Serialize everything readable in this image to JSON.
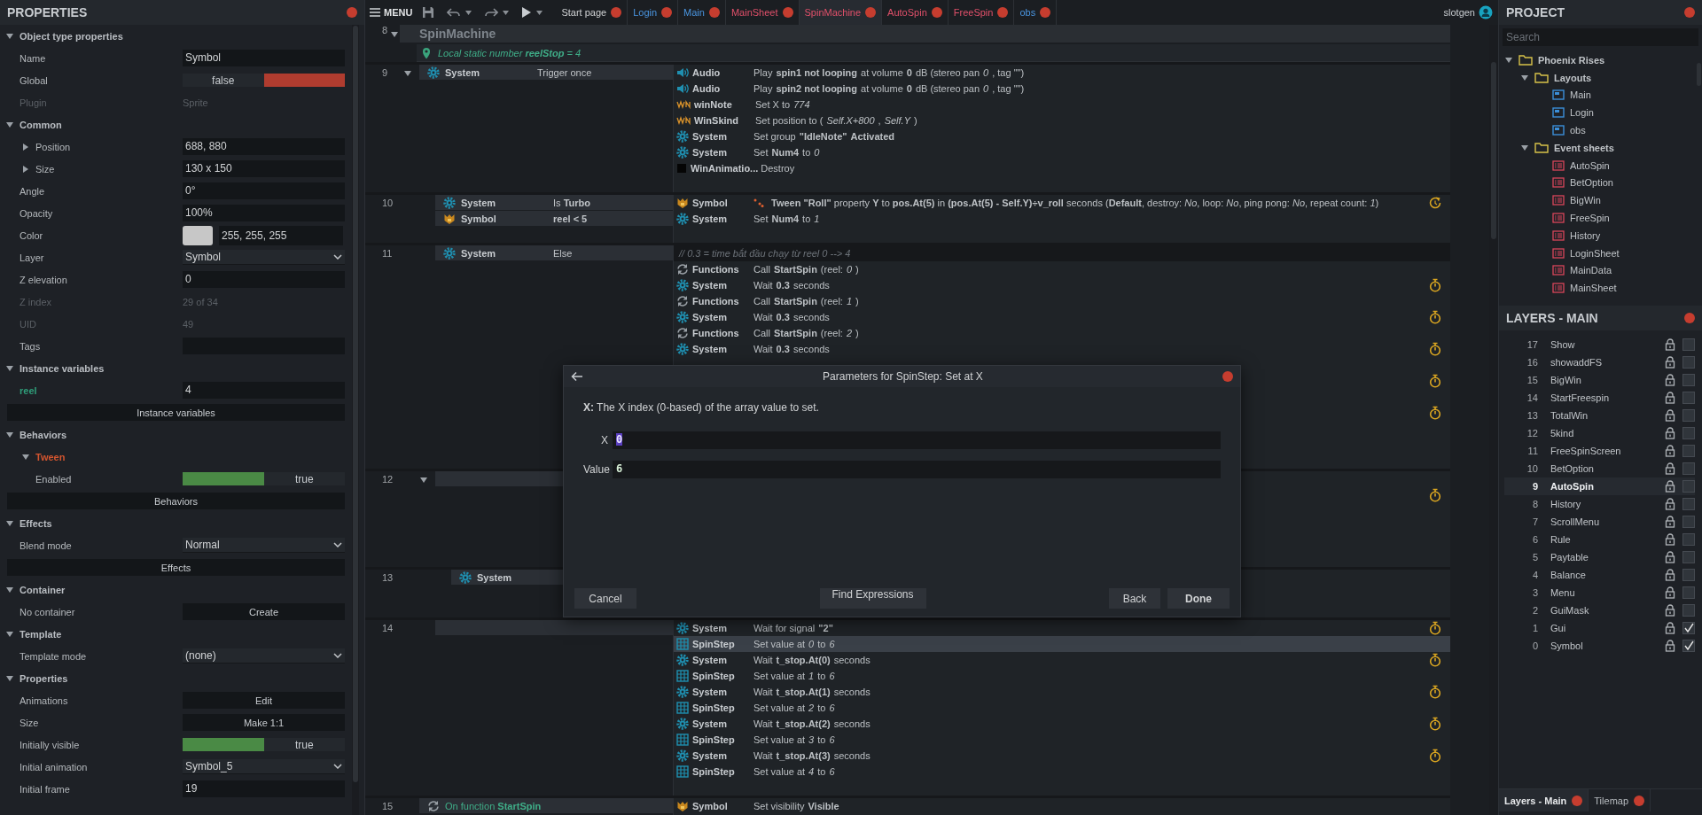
{
  "properties_panel": {
    "title": "PROPERTIES",
    "sections": [
      {
        "label": "Object type properties",
        "expanded": true,
        "rows": [
          {
            "kind": "field",
            "label": "Name",
            "value": "Symbol"
          },
          {
            "kind": "toggle",
            "label": "Global",
            "value": "false",
            "on": false
          },
          {
            "kind": "readonly",
            "label": "Plugin",
            "value": "Sprite"
          }
        ]
      },
      {
        "label": "Common",
        "expanded": true,
        "rows": [
          {
            "kind": "expander",
            "label": "Position",
            "value": "688, 880",
            "expanded": false
          },
          {
            "kind": "expander",
            "label": "Size",
            "value": "130 x 150",
            "expanded": false
          },
          {
            "kind": "field",
            "label": "Angle",
            "value": "0°"
          },
          {
            "kind": "field",
            "label": "Opacity",
            "value": "100%"
          },
          {
            "kind": "color",
            "label": "Color",
            "value": "255, 255, 255"
          },
          {
            "kind": "dropdown",
            "label": "Layer",
            "value": "Symbol"
          },
          {
            "kind": "field",
            "label": "Z elevation",
            "value": "0"
          },
          {
            "kind": "readonly",
            "label": "Z index",
            "value": "29 of 34"
          },
          {
            "kind": "readonly",
            "label": "UID",
            "value": "49"
          },
          {
            "kind": "field",
            "label": "Tags"
          }
        ]
      },
      {
        "label": "Instance variables",
        "expanded": true,
        "rows": [
          {
            "kind": "variable",
            "label": "reel",
            "value": "4"
          },
          {
            "kind": "wide_button",
            "label": "Instance variables"
          }
        ]
      },
      {
        "label": "Behaviors",
        "expanded": true,
        "rows": [
          {
            "kind": "subsection",
            "label": "Tween",
            "expanded": true,
            "rows": [
              {
                "kind": "toggle",
                "label": "Enabled",
                "value": "true",
                "on": true
              }
            ]
          },
          {
            "kind": "wide_button",
            "label": "Behaviors"
          }
        ]
      },
      {
        "label": "Effects",
        "expanded": true,
        "rows": [
          {
            "kind": "dropdown",
            "label": "Blend mode",
            "value": "Normal"
          },
          {
            "kind": "wide_button",
            "label": "Effects"
          }
        ]
      },
      {
        "label": "Container",
        "expanded": true,
        "rows": [
          {
            "kind": "button",
            "label": "No container",
            "value": "Create"
          }
        ]
      },
      {
        "label": "Template",
        "expanded": true,
        "rows": [
          {
            "kind": "dropdown",
            "label": "Template mode",
            "value": "(none)"
          }
        ]
      },
      {
        "label": "Properties",
        "expanded": true,
        "rows": [
          {
            "kind": "button",
            "label": "Animations",
            "value": "Edit"
          },
          {
            "kind": "button",
            "label": "Size",
            "value": "Make 1:1"
          },
          {
            "kind": "toggle",
            "label": "Initially visible",
            "value": "true",
            "on": true
          },
          {
            "kind": "dropdown",
            "label": "Initial animation",
            "value": "Symbol_5"
          },
          {
            "kind": "field",
            "label": "Initial frame",
            "value": "19"
          }
        ]
      }
    ]
  },
  "toolbar": {
    "menu": "MENU",
    "tabs": [
      {
        "label": "Start page",
        "kind": "start",
        "selected": false
      },
      {
        "label": "Login",
        "kind": "layout",
        "selected": false
      },
      {
        "label": "Main",
        "kind": "layout",
        "selected": false
      },
      {
        "label": "MainSheet",
        "kind": "sheet",
        "selected": false
      },
      {
        "label": "SpinMachine",
        "kind": "sheet",
        "selected": true
      },
      {
        "label": "AutoSpin",
        "kind": "sheet",
        "selected": false
      },
      {
        "label": "FreeSpin",
        "kind": "sheet",
        "selected": false
      },
      {
        "label": "obs",
        "kind": "layout",
        "selected": false
      }
    ],
    "user": "slotgen"
  },
  "event_sheet": {
    "group": {
      "number": "8",
      "title": "SpinMachine",
      "expanded": true
    },
    "local_variable": "Local static number **reelStop** = 4",
    "events": [
      {
        "number": "9",
        "expanded": true,
        "conditions": [
          {
            "kind": "system",
            "object": "System",
            "text": "Trigger once"
          }
        ],
        "actions": [
          {
            "kind": "audio",
            "object": "Audio",
            "text": "Play **spin1 not looping** at volume **0** dB (stereo pan *0*, tag \"\")",
            "selected": false
          },
          {
            "kind": "audio",
            "object": "Audio",
            "text": "Play **spin2 not looping** at volume **0** dB (stereo pan *0*, tag \"\")",
            "selected": false
          },
          {
            "kind": "sprite",
            "object": "winNote",
            "text": "Set X to *774*",
            "selected": false
          },
          {
            "kind": "sprite",
            "object": "WinSkind",
            "text": "Set position to (*Self.X+800*, *Self.Y*)",
            "selected": false
          },
          {
            "kind": "system",
            "object": "System",
            "text": "Set group **\"IdleNote\"** **Activated**",
            "selected": false
          },
          {
            "kind": "system",
            "object": "System",
            "text": "Set **Num4** to *0*",
            "selected": false
          },
          {
            "kind": "animation",
            "object": "WinAnimatio...",
            "text": "Destroy",
            "selected": false
          }
        ],
        "children": [
          {
            "number": "10",
            "conditions": [
              {
                "kind": "system",
                "object": "System",
                "text": "Is **Turbo**"
              },
              {
                "kind": "symbol",
                "object": "Symbol",
                "text": "**reel < 5**"
              }
            ],
            "actions": [
              {
                "kind": "symbol",
                "object": "Symbol",
                "behavior": true,
                "text": "**Tween** **\"Roll\"** property **Y** to **pos.At(5)** in **(pos.At(5) - Self.Y)÷v_roll** seconds (**Default**, destroy: *No*, loop: *No*, ping pong: *No*, repeat count: *1*)",
                "async": true,
                "selected": false
              },
              {
                "kind": "system",
                "object": "System",
                "text": "Set **Num4** to *1*",
                "selected": false
              }
            ]
          },
          {
            "number": "11",
            "conditions": [
              {
                "kind": "system",
                "object": "System",
                "text": "Else"
              }
            ],
            "comment": "//  0.3 = time bắt đầu chạy từ reel 0 --> 4",
            "actions": [
              {
                "kind": "function",
                "object": "Functions",
                "text": "Call **StartSpin** (reel: *0*)",
                "selected": false
              },
              {
                "kind": "system",
                "object": "System",
                "text": "Wait **0.3** seconds",
                "wait": true,
                "selected": false
              },
              {
                "kind": "function",
                "object": "Functions",
                "text": "Call **StartSpin** (reel: *1*)",
                "selected": false
              },
              {
                "kind": "system",
                "object": "System",
                "text": "Wait **0.3** seconds",
                "wait": true,
                "selected": false
              },
              {
                "kind": "function",
                "object": "Functions",
                "text": "Call **StartSpin** (reel: *2*)",
                "selected": false
              },
              {
                "kind": "system",
                "object": "System",
                "text": "Wait **0.3** seconds",
                "wait": true,
                "selected": false
              },
              {
                "wait": false
              },
              {
                "wait": true
              },
              {
                "wait": false
              },
              {
                "wait": true
              },
              {
                "wait": false
              },
              {
                "wait": false
              }
            ]
          },
          {
            "number": "12",
            "expanded": true,
            "actions": [
              {
                "wait": false
              },
              {
                "wait": true
              },
              {
                "wait": false
              },
              {
                "wait": false
              },
              {
                "wait": false
              }
            ],
            "children": [
              {
                "number": "13",
                "conditions": [
                  {
                    "kind": "system",
                    "object": "System"
                  }
                ],
                "actions": [
                  {
                    "wait": false
                  },
                  {
                    "wait": false
                  }
                ]
              }
            ]
          },
          {
            "number": "14",
            "actions": [
              {
                "kind": "system",
                "object": "System",
                "text": "Wait for signal **\"2\"**",
                "wait": true,
                "selected": false
              },
              {
                "kind": "array",
                "object": "SpinStep",
                "text": "Set value at *0* to *6*",
                "selected": true
              },
              {
                "kind": "system",
                "object": "System",
                "text": "Wait **t_stop.At(0)** seconds",
                "wait": true,
                "selected": false
              },
              {
                "kind": "array",
                "object": "SpinStep",
                "text": "Set value at *1* to *6*",
                "selected": false
              },
              {
                "kind": "system",
                "object": "System",
                "text": "Wait **t_stop.At(1)** seconds",
                "wait": true,
                "selected": false
              },
              {
                "kind": "array",
                "object": "SpinStep",
                "text": "Set value at *2* to *6*",
                "selected": false
              },
              {
                "kind": "system",
                "object": "System",
                "text": "Wait **t_stop.At(2)** seconds",
                "wait": true,
                "selected": false
              },
              {
                "kind": "array",
                "object": "SpinStep",
                "text": "Set value at *3* to *6*",
                "selected": false
              },
              {
                "kind": "system",
                "object": "System",
                "text": "Wait **t_stop.At(3)** seconds",
                "wait": true,
                "selected": false
              },
              {
                "kind": "array",
                "object": "SpinStep",
                "text": "Set value at *4* to *6*",
                "selected": false
              }
            ]
          }
        ]
      },
      {
        "number": "15",
        "conditions": [
          {
            "kind": "function",
            "text": "On function **StartSpin**"
          }
        ],
        "actions": [
          {
            "kind": "symbol",
            "object": "Symbol",
            "text": "Set visibility **Visible**",
            "selected": false
          }
        ]
      }
    ]
  },
  "dialog": {
    "title": "Parameters for SpinStep: Set at X",
    "description": "**X:** The X index (0-based) of the array value to set.",
    "params": [
      {
        "label": "X",
        "value": "0",
        "selected": true
      },
      {
        "label": "Value",
        "value": "6",
        "selected": false
      }
    ],
    "buttons": [
      {
        "label": "Cancel",
        "kind": "left"
      },
      {
        "label": "Find Expressions",
        "kind": "center"
      },
      {
        "label": "Back",
        "kind": "right"
      },
      {
        "label": "Done",
        "kind": "primary"
      }
    ]
  },
  "project_panel": {
    "title": "PROJECT",
    "search_placeholder": "Search",
    "tree": [
      {
        "label": "Phoenix Rises",
        "kind": "folder",
        "expanded": true,
        "children": [
          {
            "label": "Layouts",
            "kind": "folder",
            "expanded": true,
            "children": [
              {
                "label": "Main",
                "kind": "layout"
              },
              {
                "label": "Login",
                "kind": "layout"
              },
              {
                "label": "obs",
                "kind": "layout"
              }
            ]
          },
          {
            "label": "Event sheets",
            "kind": "folder",
            "expanded": true,
            "children": [
              {
                "label": "AutoSpin",
                "kind": "sheet"
              },
              {
                "label": "BetOption",
                "kind": "sheet"
              },
              {
                "label": "BigWin",
                "kind": "sheet"
              },
              {
                "label": "FreeSpin",
                "kind": "sheet"
              },
              {
                "label": "History",
                "kind": "sheet"
              },
              {
                "label": "LoginSheet",
                "kind": "sheet"
              },
              {
                "label": "MainData",
                "kind": "sheet"
              },
              {
                "label": "MainSheet",
                "kind": "sheet"
              }
            ]
          }
        ]
      }
    ]
  },
  "layers_panel": {
    "title": "LAYERS - MAIN",
    "layers": [
      {
        "number": "17",
        "name": "Show",
        "selected": false,
        "visible": false
      },
      {
        "number": "16",
        "name": "showaddFS",
        "selected": false,
        "visible": false
      },
      {
        "number": "15",
        "name": "BigWin",
        "selected": false,
        "visible": false
      },
      {
        "number": "14",
        "name": "StartFreespin",
        "selected": false,
        "visible": false
      },
      {
        "number": "13",
        "name": "TotalWin",
        "selected": false,
        "visible": false
      },
      {
        "number": "12",
        "name": "5kind",
        "selected": false,
        "visible": false
      },
      {
        "number": "11",
        "name": "FreeSpinScreen",
        "selected": false,
        "visible": false
      },
      {
        "number": "10",
        "name": "BetOption",
        "selected": false,
        "visible": false
      },
      {
        "number": "9",
        "name": "AutoSpin",
        "selected": true,
        "visible": false
      },
      {
        "number": "8",
        "name": "History",
        "selected": false,
        "visible": false
      },
      {
        "number": "7",
        "name": "ScrollMenu",
        "selected": false,
        "visible": false
      },
      {
        "number": "6",
        "name": "Rule",
        "selected": false,
        "visible": false
      },
      {
        "number": "5",
        "name": "Paytable",
        "selected": false,
        "visible": false
      },
      {
        "number": "4",
        "name": "Balance",
        "selected": false,
        "visible": false
      },
      {
        "number": "3",
        "name": "Menu",
        "selected": false,
        "visible": false
      },
      {
        "number": "2",
        "name": "GuiMask",
        "selected": false,
        "visible": false
      },
      {
        "number": "1",
        "name": "Gui",
        "selected": false,
        "visible": true
      },
      {
        "number": "0",
        "name": "Symbol",
        "selected": false,
        "visible": true
      }
    ],
    "tabs": [
      {
        "label": "Layers - Main",
        "selected": true
      },
      {
        "label": "Tilemap",
        "selected": false
      }
    ]
  }
}
